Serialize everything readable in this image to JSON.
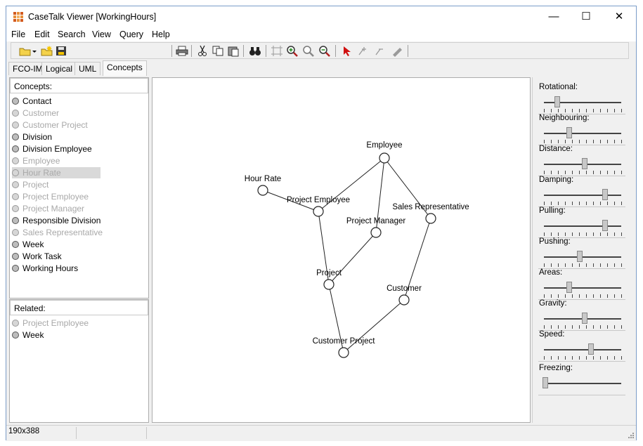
{
  "window": {
    "title": "CaseTalk Viewer [WorkingHours]",
    "minimize_glyph": "—",
    "maximize_glyph": "☐",
    "close_glyph": "✕"
  },
  "menu": [
    "File",
    "Edit",
    "Search",
    "View",
    "Query",
    "Help"
  ],
  "toolbar_icons": [
    "open-folder-icon",
    "dropdown-arrow-icon",
    "new-folder-icon",
    "save-disk-icon",
    "print-icon",
    "cut-icon",
    "copy-icon",
    "paste-icon",
    "find-binoculars-icon",
    "fit-icon",
    "zoom-in-icon",
    "zoom-icon",
    "zoom-out-icon",
    "select-arrow-icon",
    "add-point-icon",
    "remove-point-icon",
    "pen-icon"
  ],
  "tabs": [
    "FCO-IM",
    "Logical",
    "UML",
    "Concepts"
  ],
  "active_tab": "Concepts",
  "concepts": {
    "header": "Concepts:",
    "items": [
      {
        "label": "Contact",
        "state": "enabled"
      },
      {
        "label": "Customer",
        "state": "disabled"
      },
      {
        "label": "Customer Project",
        "state": "disabled"
      },
      {
        "label": "Division",
        "state": "enabled"
      },
      {
        "label": "Division Employee",
        "state": "enabled"
      },
      {
        "label": "Employee",
        "state": "disabled"
      },
      {
        "label": "Hour Rate",
        "state": "selected"
      },
      {
        "label": "Project",
        "state": "disabled"
      },
      {
        "label": "Project Employee",
        "state": "disabled"
      },
      {
        "label": "Project Manager",
        "state": "disabled"
      },
      {
        "label": "Responsible Division",
        "state": "enabled"
      },
      {
        "label": "Sales Representative",
        "state": "disabled"
      },
      {
        "label": "Week",
        "state": "enabled"
      },
      {
        "label": "Work Task",
        "state": "enabled"
      },
      {
        "label": "Working Hours",
        "state": "enabled"
      }
    ]
  },
  "related": {
    "header": "Related:",
    "items": [
      {
        "label": "Project Employee",
        "state": "disabled"
      },
      {
        "label": "Week",
        "state": "enabled"
      }
    ]
  },
  "graph": {
    "nodes": [
      {
        "id": "employee",
        "label": "Employee"
      },
      {
        "id": "hour_rate",
        "label": "Hour Rate"
      },
      {
        "id": "project_employee",
        "label": "Project Employee"
      },
      {
        "id": "project_manager",
        "label": "Project Manager"
      },
      {
        "id": "sales_rep",
        "label": "Sales Representative"
      },
      {
        "id": "project",
        "label": "Project"
      },
      {
        "id": "customer",
        "label": "Customer"
      },
      {
        "id": "customer_project",
        "label": "Customer Project"
      }
    ],
    "edges": [
      [
        "employee",
        "project_employee"
      ],
      [
        "employee",
        "project_manager"
      ],
      [
        "employee",
        "sales_rep"
      ],
      [
        "hour_rate",
        "project_employee"
      ],
      [
        "project_employee",
        "project"
      ],
      [
        "project_manager",
        "project"
      ],
      [
        "project",
        "customer_project"
      ],
      [
        "sales_rep",
        "customer"
      ],
      [
        "customer",
        "customer_project"
      ]
    ]
  },
  "sliders": [
    {
      "label": "Rotational:",
      "value": 0.16
    },
    {
      "label": "Neighbouring:",
      "value": 0.32
    },
    {
      "label": "Distance:",
      "value": 0.53
    },
    {
      "label": "Damping:",
      "value": 0.8
    },
    {
      "label": "Pulling:",
      "value": 0.8
    },
    {
      "label": "Pushing:",
      "value": 0.46
    },
    {
      "label": "Areas:",
      "value": 0.32
    },
    {
      "label": "Gravity:",
      "value": 0.53
    },
    {
      "label": "Speed:",
      "value": 0.61
    },
    {
      "label": "Freezing:",
      "value": 0.0
    }
  ],
  "status": {
    "size": "190x388"
  }
}
